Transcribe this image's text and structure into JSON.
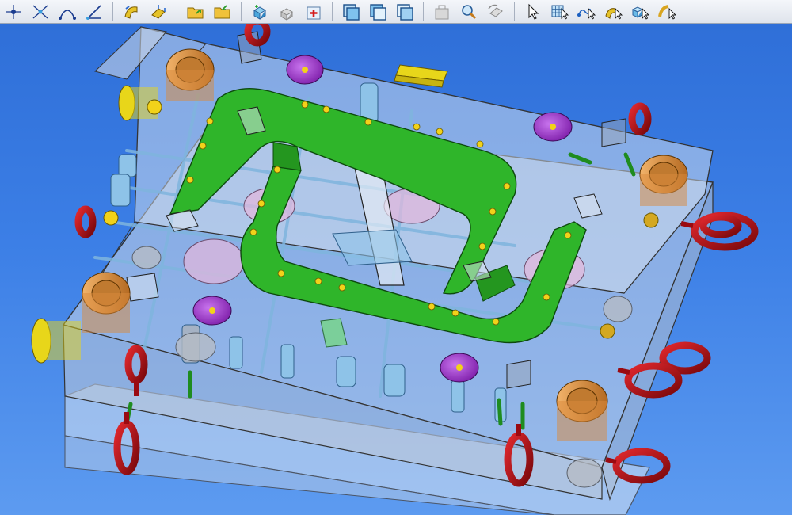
{
  "toolbar": {
    "groups": [
      [
        "point-icon",
        "cross-points-icon",
        "arc-icon",
        "axis-icon"
      ],
      [
        "sweep-icon",
        "extrude-icon"
      ],
      [
        "folder-open-icon",
        "folder-add-icon"
      ],
      [
        "assembly-add-icon",
        "component-gray-icon",
        "component-add-icon"
      ],
      [
        "view-front-icon",
        "view-top-icon",
        "view-right-icon"
      ],
      [
        "inactive-block-icon",
        "zoom-icon",
        "rotate-icon"
      ],
      [
        "select-cursor-icon",
        "grid-select-icon",
        "path-select-icon",
        "surface-select-icon",
        "solid-select-icon",
        "curve-select-icon"
      ]
    ]
  },
  "viewport": {
    "background": "#3576e0",
    "mold_plate_color": "#c8d4e4",
    "core_frame_color": "#2fb52a",
    "eyebolt_color": "#b30f14",
    "bushing_color": "#d98a3c",
    "disk_color": "#9a2cc4",
    "pin_color": "#8ec3e8",
    "locator_color": "#e8d61a"
  }
}
